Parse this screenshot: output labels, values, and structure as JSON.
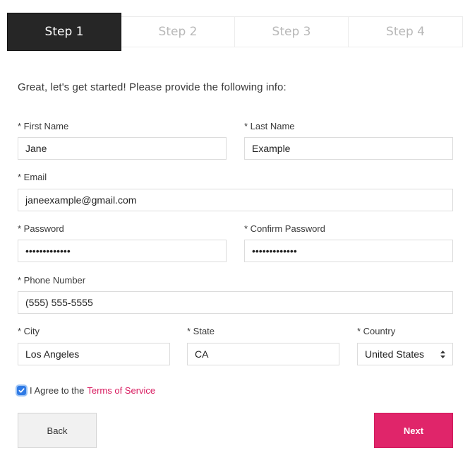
{
  "steps": [
    {
      "label": "Step 1",
      "active": true
    },
    {
      "label": "Step 2",
      "active": false
    },
    {
      "label": "Step 3",
      "active": false
    },
    {
      "label": "Step 4",
      "active": false
    }
  ],
  "intro": "Great, let's get started! Please provide the following info:",
  "form": {
    "first_name": {
      "label": "* First Name",
      "value": "Jane"
    },
    "last_name": {
      "label": "* Last Name",
      "value": "Example"
    },
    "email": {
      "label": "* Email",
      "value": "janeexample@gmail.com"
    },
    "password": {
      "label": "* Password",
      "value": "•••••••••••••"
    },
    "confirm_password": {
      "label": "* Confirm Password",
      "value": "•••••••••••••"
    },
    "phone": {
      "label": "* Phone Number",
      "value": "(555) 555-5555"
    },
    "city": {
      "label": "* City",
      "value": "Los Angeles"
    },
    "state": {
      "label": "* State",
      "value": "CA"
    },
    "country": {
      "label": "* Country",
      "value": "United States"
    }
  },
  "agree": {
    "checked": true,
    "text": "I Agree to the",
    "link": "Terms of Service"
  },
  "buttons": {
    "back": "Back",
    "next": "Next"
  },
  "colors": {
    "active_step_bg": "#262626",
    "accent": "#e0256a",
    "link": "#d8195e",
    "checkbox": "#2f7ae5"
  }
}
